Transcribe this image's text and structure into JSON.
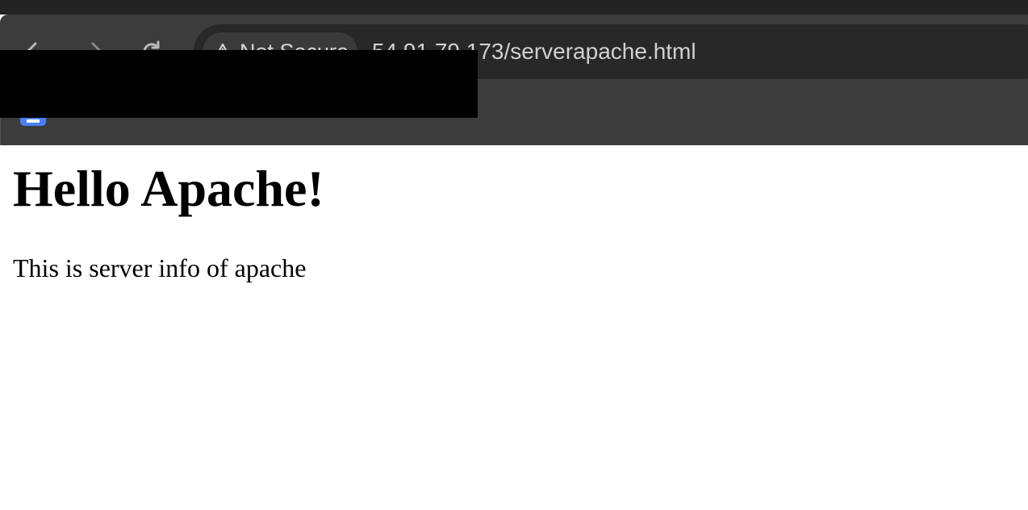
{
  "browser": {
    "address_bar": {
      "security_label": "Not Secure",
      "url": "54.91.79.173/serverapache.html"
    },
    "nav_icons": [
      "back-arrow-icon",
      "forward-arrow-icon",
      "reload-icon"
    ],
    "colors": {
      "toolbar": "#3c3c3c",
      "omnibox": "#282828",
      "bookmark_icon": "#4a7ff0"
    }
  },
  "page": {
    "heading": "Hello Apache!",
    "paragraph": "This is server info of apache"
  }
}
